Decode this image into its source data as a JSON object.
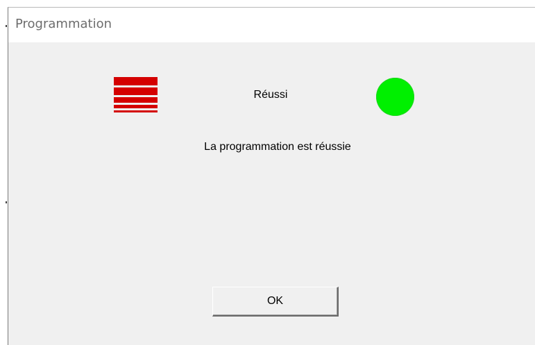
{
  "window": {
    "title": "Programmation"
  },
  "dialog": {
    "status_label": "Réussi",
    "message": "La programmation est réussie",
    "ok_label": "OK"
  },
  "colors": {
    "logo": "#d40000",
    "status_indicator": "#00f000"
  },
  "icons": {
    "logo": "striped-logo-icon",
    "status": "success-indicator-icon"
  }
}
